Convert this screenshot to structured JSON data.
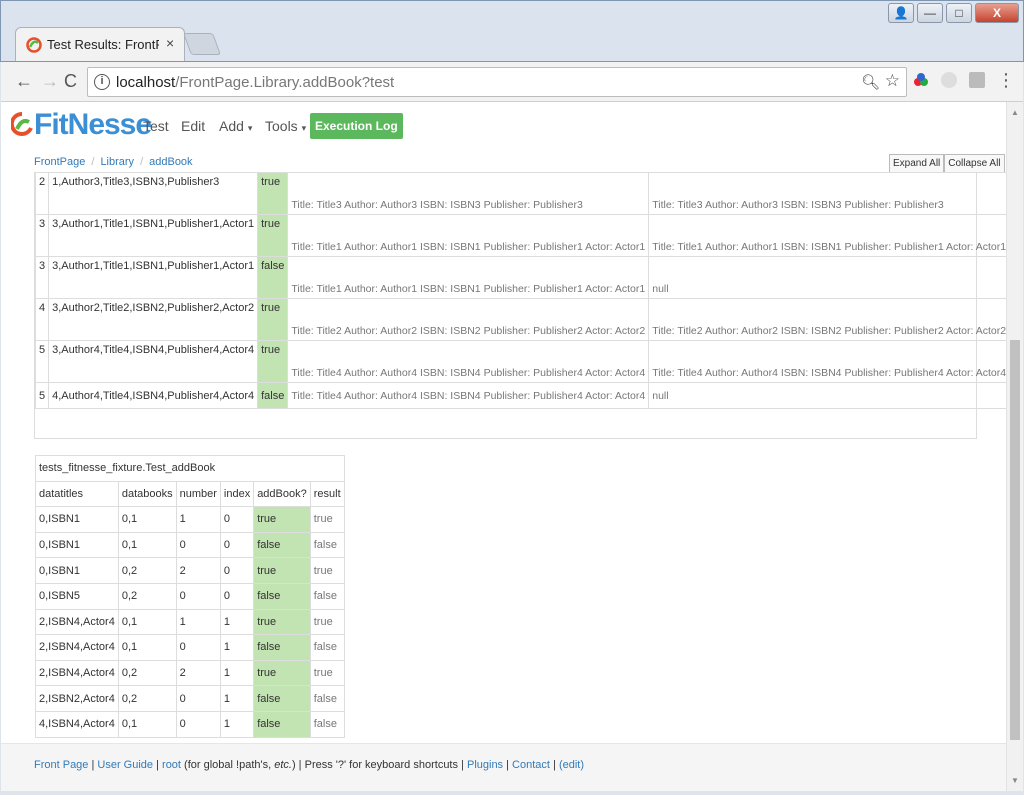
{
  "window": {
    "tab_title": "Test Results: FrontPage.Li",
    "tab_close": "×",
    "controls": {
      "minimize": "—",
      "maximize": "□",
      "close": "X",
      "profile": "👤"
    }
  },
  "toolbar": {
    "back": "←",
    "forward": "→",
    "reload": "C",
    "url_host": "localhost",
    "url_path": "/FrontPage.Library.addBook?test"
  },
  "header": {
    "logo_text": "FitNesse",
    "nav": {
      "test": "Test",
      "edit": "Edit",
      "add": "Add",
      "tools": "Tools",
      "caret": "▾",
      "execution_log": "Execution Log"
    }
  },
  "breadcrumb": [
    "FrontPage",
    "Library",
    "addBook"
  ],
  "expand_all": "Expand All",
  "collapse_all": "Collapse All",
  "results_table": {
    "rows": [
      {
        "c1": "2",
        "c2": "1,Author3,Title3,ISBN3,Publisher3",
        "c3": "true",
        "c4": "Title: Title3 Author: Author3 ISBN: ISBN3 Publisher: Publisher3",
        "c5": "Title: Title3 Author: Author3 ISBN: ISBN3 Publisher: Publisher3"
      },
      {
        "c1": "3",
        "c2": "3,Author1,Title1,ISBN1,Publisher1,Actor1",
        "c3": "true",
        "c4": "Title: Title1 Author: Author1 ISBN: ISBN1 Publisher: Publisher1 Actor: Actor1",
        "c5": "Title: Title1 Author: Author1 ISBN: ISBN1 Publisher: Publisher1 Actor: Actor1"
      },
      {
        "c1": "3",
        "c2": "3,Author1,Title1,ISBN1,Publisher1,Actor1",
        "c3": "false",
        "c4": "Title: Title1 Author: Author1 ISBN: ISBN1 Publisher: Publisher1 Actor: Actor1",
        "c5": "null"
      },
      {
        "c1": "4",
        "c2": "3,Author2,Title2,ISBN2,Publisher2,Actor2",
        "c3": "true",
        "c4": "Title: Title2 Author: Author2 ISBN: ISBN2 Publisher: Publisher2 Actor: Actor2",
        "c5": "Title: Title2 Author: Author2 ISBN: ISBN2 Publisher: Publisher2 Actor: Actor2"
      },
      {
        "c1": "5",
        "c2": "3,Author4,Title4,ISBN4,Publisher4,Actor4",
        "c3": "true",
        "c4": "Title: Title4 Author: Author4 ISBN: ISBN4 Publisher: Publisher4 Actor: Actor4",
        "c5": "Title: Title4 Author: Author4 ISBN: ISBN4 Publisher: Publisher4 Actor: Actor4"
      },
      {
        "c1": "5",
        "c2": "4,Author4,Title4,ISBN4,Publisher4,Actor4",
        "c3": "false",
        "c4": "Title: Title4 Author: Author4 ISBN: ISBN4 Publisher: Publisher4 Actor: Actor4",
        "c5": "null"
      }
    ]
  },
  "fixture_table": {
    "caption": "tests_fitnesse_fixture.Test_addBook",
    "headers": [
      "datatitles",
      "databooks",
      "number",
      "index",
      "addBook?",
      "result"
    ],
    "rows": [
      [
        "0,ISBN1",
        "0,1",
        "1",
        "0",
        "true",
        "true"
      ],
      [
        "0,ISBN1",
        "0,1",
        "0",
        "0",
        "false",
        "false"
      ],
      [
        "0,ISBN1",
        "0,2",
        "2",
        "0",
        "true",
        "true"
      ],
      [
        "0,ISBN5",
        "0,2",
        "0",
        "0",
        "false",
        "false"
      ],
      [
        "2,ISBN4,Actor4",
        "0,1",
        "1",
        "1",
        "true",
        "true"
      ],
      [
        "2,ISBN4,Actor4",
        "0,1",
        "0",
        "1",
        "false",
        "false"
      ],
      [
        "2,ISBN4,Actor4",
        "0,2",
        "2",
        "1",
        "true",
        "true"
      ],
      [
        "2,ISBN2,Actor4",
        "0,2",
        "0",
        "1",
        "false",
        "false"
      ],
      [
        "4,ISBN4,Actor4",
        "0,1",
        "0",
        "1",
        "false",
        "false"
      ]
    ]
  },
  "footer": {
    "front_page": "Front Page",
    "sep": " | ",
    "user_guide": "User Guide",
    "root": "root",
    "root_note_pre": " (for global !path's, ",
    "root_note_em": "etc.",
    "root_note_post": ")",
    "shortcuts": "Press '?' for keyboard shortcuts",
    "plugins": "Plugins",
    "contact": "Contact",
    "edit": "(edit)"
  },
  "colors": {
    "pass": "#c2e3b2",
    "link": "#337ab7",
    "execution_log": "#5cb85c",
    "logo": "#3b8fd4"
  }
}
